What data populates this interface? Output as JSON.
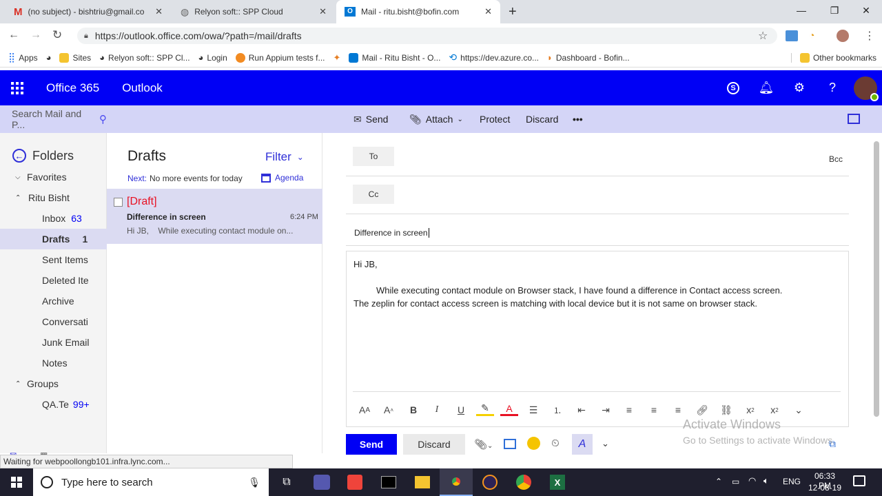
{
  "browser": {
    "tabs": [
      {
        "title": "(no subject) - bishtriu@gmail.co",
        "icon": "gmail-icon",
        "color": "#d93025"
      },
      {
        "title": "Relyon soft:: SPP Cloud",
        "icon": "globe-icon",
        "color": "#666666"
      },
      {
        "title": "Mail - ritu.bisht@bofin.com",
        "icon": "outlook-icon",
        "color": "#0078d4"
      }
    ],
    "url": "https://outlook.office.com/owa/?path=/mail/drafts",
    "bookmarks": [
      {
        "label": "Apps",
        "icon": "apps-grid-icon",
        "color": "#4285f4"
      },
      {
        "label": "",
        "icon": "globe-icon",
        "color": "#333333"
      },
      {
        "label": "Sites",
        "icon": "folder-icon",
        "color": "#f4c430"
      },
      {
        "label": "Relyon soft:: SPP Cl...",
        "icon": "globe-icon",
        "color": "#333333"
      },
      {
        "label": "Login",
        "icon": "globe-icon",
        "color": "#333333"
      },
      {
        "label": "Run Appium tests f...",
        "icon": "browserstack-icon",
        "color": "#f28b22"
      },
      {
        "label": "",
        "icon": "pinwheel-icon",
        "color": "#e67e22"
      },
      {
        "label": "Mail - Ritu Bisht - O...",
        "icon": "outlook-icon",
        "color": "#0078d4"
      },
      {
        "label": "https://dev.azure.co...",
        "icon": "azure-devops-icon",
        "color": "#0078d4"
      },
      {
        "label": "Dashboard - Bofin...",
        "icon": "dashboard-icon",
        "color": "#e67e22"
      }
    ],
    "other_bookmarks": "Other bookmarks"
  },
  "header": {
    "suite": "Office 365",
    "app": "Outlook"
  },
  "search": {
    "placeholder": "Search Mail and P..."
  },
  "commands": {
    "send": "Send",
    "attach": "Attach",
    "protect": "Protect",
    "discard": "Discard",
    "more": "•••"
  },
  "folders": {
    "title": "Folders",
    "favorites": "Favorites",
    "account": "Ritu Bisht",
    "items": [
      {
        "label": "Inbox",
        "count": "63"
      },
      {
        "label": "Drafts",
        "count": "1"
      },
      {
        "label": "Sent Items",
        "count": ""
      },
      {
        "label": "Deleted Ite",
        "count": ""
      },
      {
        "label": "Archive",
        "count": ""
      },
      {
        "label": "Conversati",
        "count": ""
      },
      {
        "label": "Junk Email",
        "count": ""
      },
      {
        "label": "Notes",
        "count": ""
      }
    ],
    "groups": "Groups",
    "group_items": [
      {
        "label": "QA.Te",
        "count": "99+"
      }
    ]
  },
  "list": {
    "title": "Drafts",
    "filter": "Filter",
    "next_label": "Next:",
    "next_text": "No more events for today",
    "agenda": "Agenda",
    "message": {
      "tag": "[Draft]",
      "subject": "Difference in screen",
      "time": "6:24 PM",
      "preview": "Hi JB,    While executing contact module on..."
    }
  },
  "compose": {
    "to": "To",
    "cc": "Cc",
    "bcc": "Bcc",
    "subject": "Difference in screen",
    "greeting": "Hi JB,",
    "body_line1": "While executing contact module on Browser stack, I have found a difference in Contact access screen.",
    "body_line2": "The zeplin for contact access screen is matching with local device but it is not same on browser stack.",
    "send": "Send",
    "discard": "Discard"
  },
  "watermark": {
    "title": "Activate Windows",
    "subtitle": "Go to Settings to activate Windows."
  },
  "status": "Waiting for webpoollongb101.infra.lync.com...",
  "taskbar": {
    "search_placeholder": "Type here to search",
    "lang": "ENG",
    "time": "06:33 PM",
    "date": "12-08-19"
  },
  "colors": {
    "brand": "#0000f5",
    "cmdbar": "#d4d5f7",
    "selected": "#dbdbf2",
    "draft_red": "#e81123"
  }
}
